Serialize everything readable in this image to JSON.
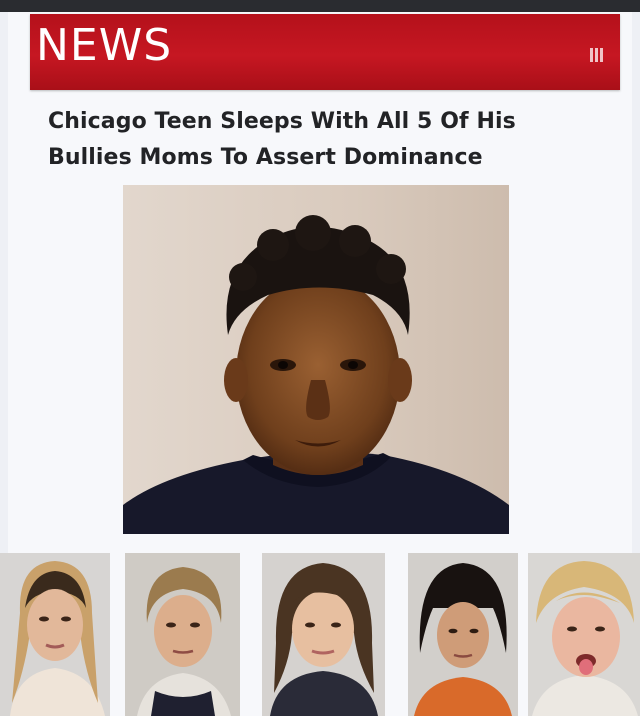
{
  "header": {
    "logo_text": "NEWS",
    "menu_icon": "menu-icon",
    "brand_color": "#c41720"
  },
  "article": {
    "headline_line1": "Chicago Teen Sleeps With All 5 Of His",
    "headline_line2": "Bullies Moms To Assert Dominance"
  },
  "images": {
    "main_photo_icon": "teen-portrait",
    "mugshot_icons": [
      "mugshot-1",
      "mugshot-2",
      "mugshot-3",
      "mugshot-4",
      "mugshot-5"
    ]
  }
}
